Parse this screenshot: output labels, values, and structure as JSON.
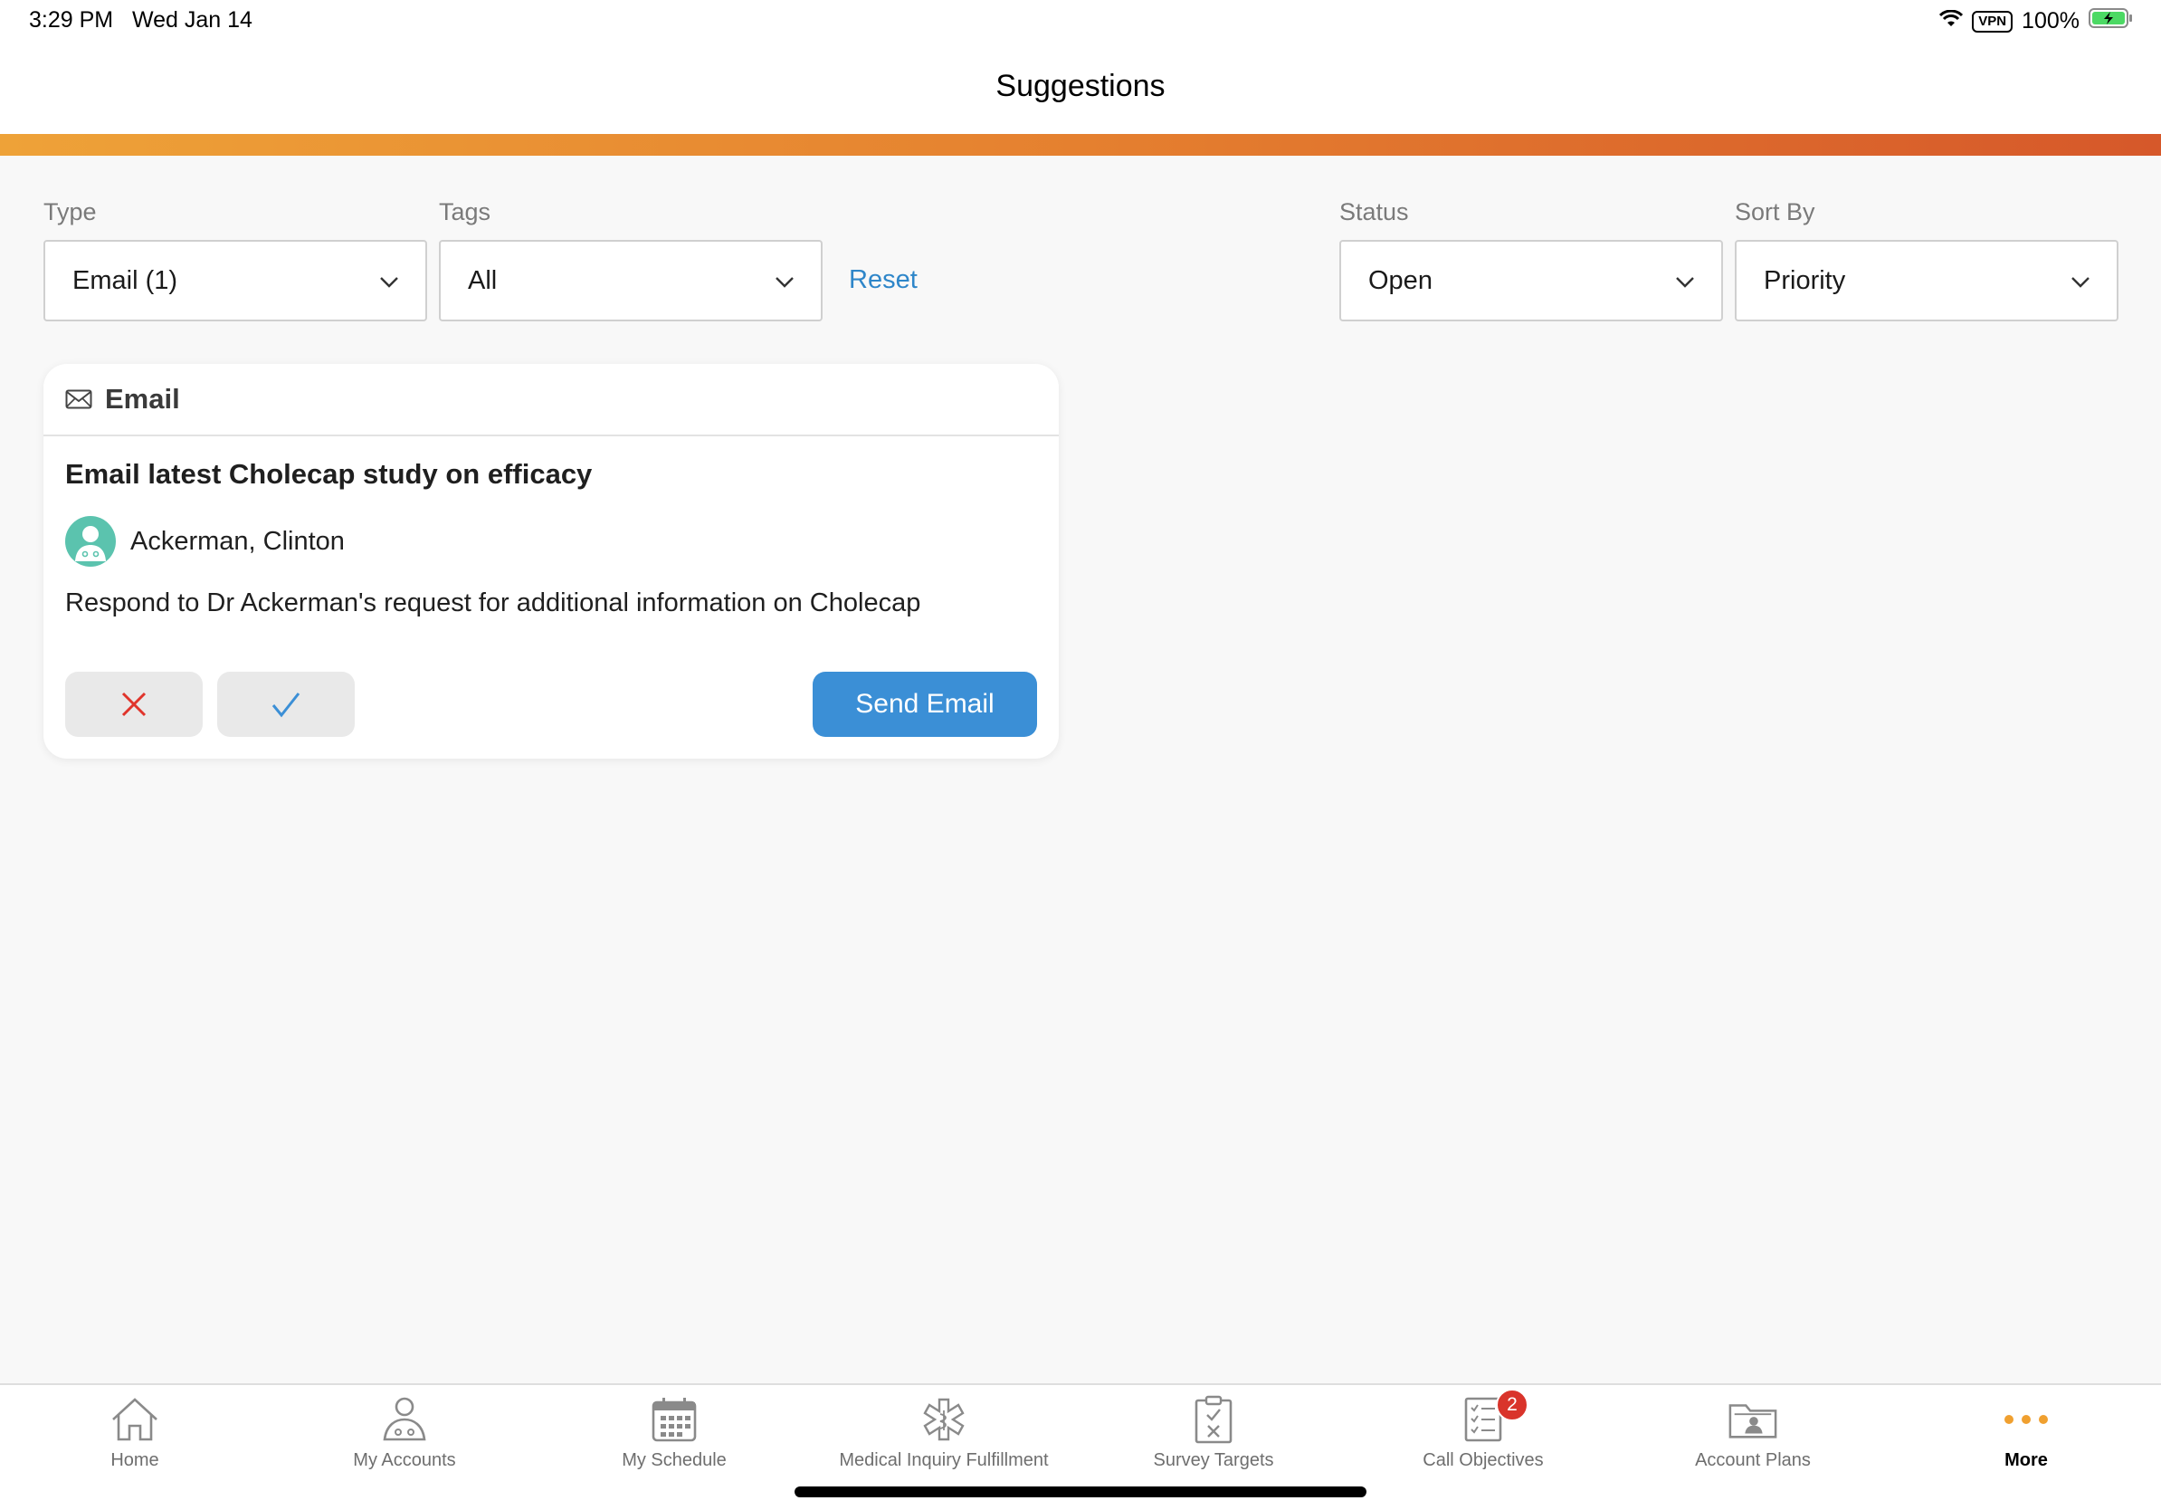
{
  "status_bar": {
    "time": "3:29 PM",
    "date": "Wed Jan 14",
    "vpn": "VPN",
    "battery": "100%"
  },
  "header": {
    "title": "Suggestions"
  },
  "colors": {
    "accent_start": "#eea238",
    "accent_end": "#d6582a",
    "link": "#2e86c9",
    "primary_button": "#3b8fd6",
    "badge": "#d9342b"
  },
  "filters": {
    "type": {
      "label": "Type",
      "value": "Email (1)"
    },
    "tags": {
      "label": "Tags",
      "value": "All"
    },
    "reset": "Reset",
    "status": {
      "label": "Status",
      "value": "Open"
    },
    "sort_by": {
      "label": "Sort By",
      "value": "Priority"
    }
  },
  "suggestion_card": {
    "type_icon": "envelope-icon",
    "type_label": "Email",
    "title": "Email latest Cholecap study on efficacy",
    "contact_name": "Ackerman, Clinton",
    "description": "Respond to Dr Ackerman's request for additional information on Cholecap",
    "dismiss_icon": "close-icon",
    "complete_icon": "checkmark-icon",
    "action_label": "Send Email"
  },
  "tab_bar": {
    "items": [
      {
        "label": "Home",
        "icon": "home-icon"
      },
      {
        "label": "My Accounts",
        "icon": "person-icon"
      },
      {
        "label": "My Schedule",
        "icon": "calendar-icon"
      },
      {
        "label": "Medical Inquiry Fulfillment",
        "icon": "medical-star-icon"
      },
      {
        "label": "Survey Targets",
        "icon": "clipboard-icon"
      },
      {
        "label": "Call Objectives",
        "icon": "checklist-icon",
        "badge": "2"
      },
      {
        "label": "Account Plans",
        "icon": "folder-icon"
      },
      {
        "label": "More",
        "icon": "more-dots-icon",
        "active": true
      }
    ]
  }
}
